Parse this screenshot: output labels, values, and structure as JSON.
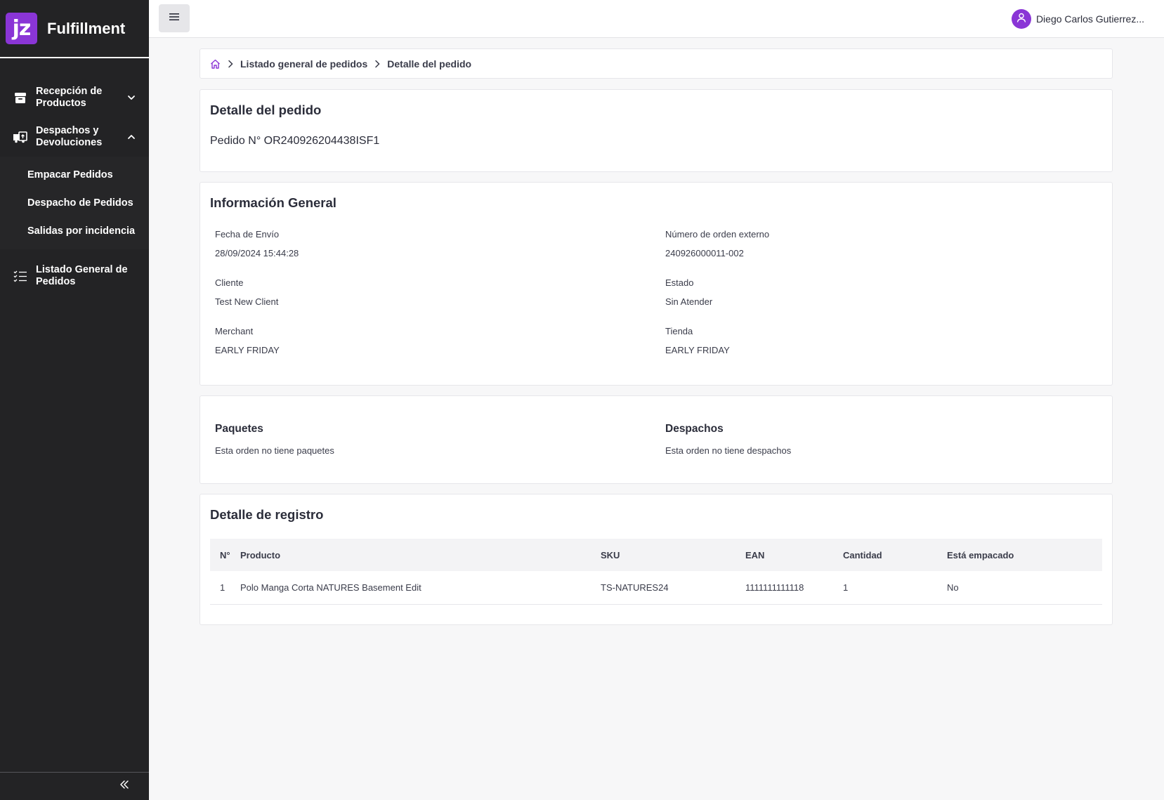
{
  "brand": {
    "logo": "jz",
    "title": "Fulfillment",
    "accent": "#8a35d6"
  },
  "sidebar": {
    "items": [
      {
        "label": "Recepción de Productos",
        "icon": "box-icon",
        "expanded": false
      },
      {
        "label": "Despachos y Devoluciones",
        "icon": "truck-box-icon",
        "expanded": true,
        "children": [
          "Empacar Pedidos",
          "Despacho de Pedidos",
          "Salidas por incidencia"
        ]
      },
      {
        "label": "Listado General de Pedidos",
        "icon": "checklist-icon"
      }
    ],
    "footer_icon": "double-chevron-left-icon"
  },
  "topbar": {
    "menu_icon": "hamburger-icon",
    "user_name": "Diego Carlos Gutierrez..."
  },
  "breadcrumb": {
    "home_icon": "home-icon",
    "items": [
      "Listado general de pedidos",
      "Detalle del pedido"
    ]
  },
  "pedido": {
    "title": "Detalle del pedido",
    "number": "Pedido N° OR240926204438ISF1"
  },
  "info": {
    "title": "Información General",
    "fields": [
      {
        "label": "Fecha de Envío",
        "value": "28/09/2024 15:44:28"
      },
      {
        "label": "Número de orden externo",
        "value": "240926000011-002"
      },
      {
        "label": "Cliente",
        "value": "Test New Client"
      },
      {
        "label": "Estado",
        "value": "Sin Atender"
      },
      {
        "label": "Merchant",
        "value": "EARLY FRIDAY"
      },
      {
        "label": "Tienda",
        "value": "EARLY FRIDAY"
      }
    ]
  },
  "paquetes": {
    "title": "Paquetes",
    "text": "Esta orden no tiene paquetes"
  },
  "despachos": {
    "title": "Despachos",
    "text": "Esta orden no tiene despachos"
  },
  "registro": {
    "title": "Detalle de registro",
    "columns": [
      "N°",
      "Producto",
      "SKU",
      "EAN",
      "Cantidad",
      "Está empacado"
    ],
    "rows": [
      [
        "1",
        "Polo Manga Corta NATURES Basement Edit",
        "TS-NATURES24",
        "1111111111118",
        "1",
        "No"
      ]
    ]
  }
}
